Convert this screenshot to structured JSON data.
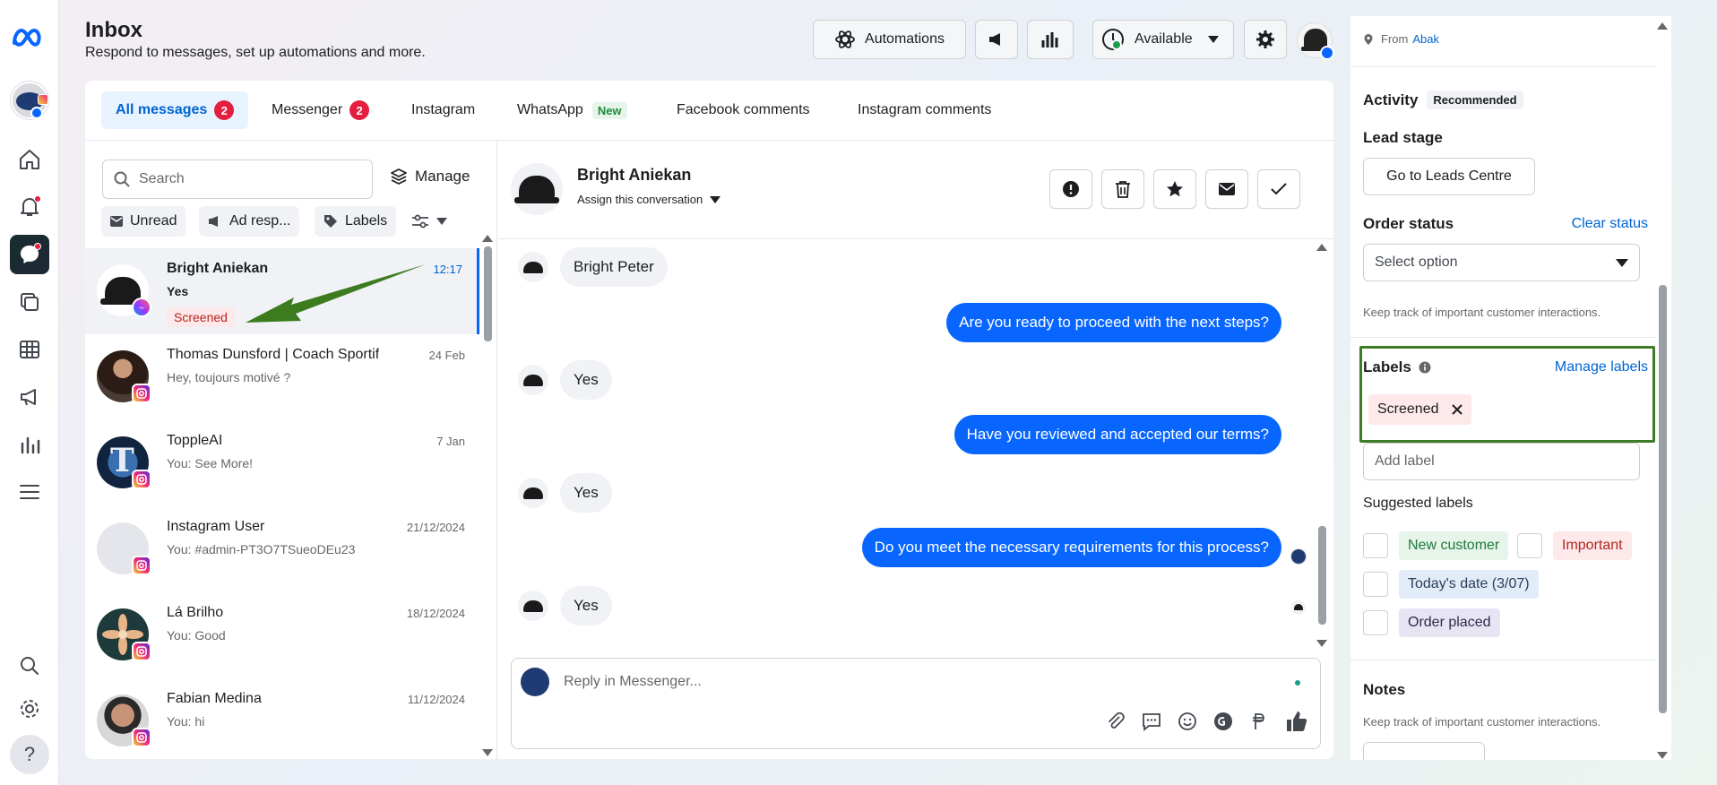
{
  "header": {
    "title": "Inbox",
    "subtitle": "Respond to messages, set up automations and more.",
    "automations_label": "Automations",
    "status_label": "Available"
  },
  "tabs": [
    {
      "label": "All messages",
      "count": "2"
    },
    {
      "label": "Messenger",
      "count": "2"
    },
    {
      "label": "Instagram"
    },
    {
      "label": "WhatsApp",
      "badge": "New"
    },
    {
      "label": "Facebook comments"
    },
    {
      "label": "Instagram comments"
    }
  ],
  "list": {
    "search_placeholder": "Search",
    "manage_label": "Manage",
    "filters": [
      "Unread",
      "Ad resp...",
      "Labels"
    ],
    "conversations": [
      {
        "name": "Bright Aniekan",
        "preview": "Yes",
        "date": "12:17",
        "label": "Screened",
        "channel": "messenger"
      },
      {
        "name": "Thomas Dunsford | Coach Sportif",
        "preview": "Hey, toujours motivé ?",
        "date": "24 Feb",
        "channel": "instagram"
      },
      {
        "name": "ToppleAI",
        "preview": "You: See More!",
        "date": "7 Jan",
        "channel": "instagram"
      },
      {
        "name": "Instagram User",
        "preview": "You: #admin-PT3O7TSueoDEu23",
        "date": "21/12/2024",
        "channel": "instagram"
      },
      {
        "name": "Lá Brilho",
        "preview": "You: Good",
        "date": "18/12/2024",
        "channel": "instagram"
      },
      {
        "name": "Fabian Medina",
        "preview": "You: hi",
        "date": "11/12/2024",
        "channel": "instagram"
      }
    ]
  },
  "chat": {
    "contact_name": "Bright Aniekan",
    "assign_label": "Assign this conversation",
    "messages": [
      {
        "dir": "in",
        "text": "Bright Peter"
      },
      {
        "dir": "out",
        "text": "Are you ready to proceed with the next steps?"
      },
      {
        "dir": "in",
        "text": "Yes"
      },
      {
        "dir": "out",
        "text": "Have you reviewed and accepted our terms?"
      },
      {
        "dir": "in",
        "text": "Yes"
      },
      {
        "dir": "out",
        "text": "Do you meet the necessary requirements for this process?"
      },
      {
        "dir": "in",
        "text": "Yes"
      }
    ],
    "reply_placeholder": "Reply in Messenger..."
  },
  "details": {
    "from_prefix": "From",
    "from_place": "Abak",
    "activity_title": "Activity",
    "activity_badge": "Recommended",
    "lead_stage_title": "Lead stage",
    "leads_button": "Go to Leads Centre",
    "order_status_title": "Order status",
    "clear_status": "Clear status",
    "select_option": "Select option",
    "order_help": "Keep track of important customer interactions.",
    "labels_title": "Labels",
    "manage_labels": "Manage labels",
    "applied_label": "Screened",
    "add_label_placeholder": "Add label",
    "suggested_title": "Suggested labels",
    "suggested": [
      "New customer",
      "Important",
      "Today's date (3/07)",
      "Order placed"
    ],
    "notes_title": "Notes",
    "notes_help": "Keep track of important customer interactions."
  },
  "colors": {
    "accent": "#0866ff",
    "link": "#0064d1",
    "highlight_box": "#3e7b27",
    "arrow": "#3d7b1f",
    "unread_badge": "#e41e3f"
  }
}
